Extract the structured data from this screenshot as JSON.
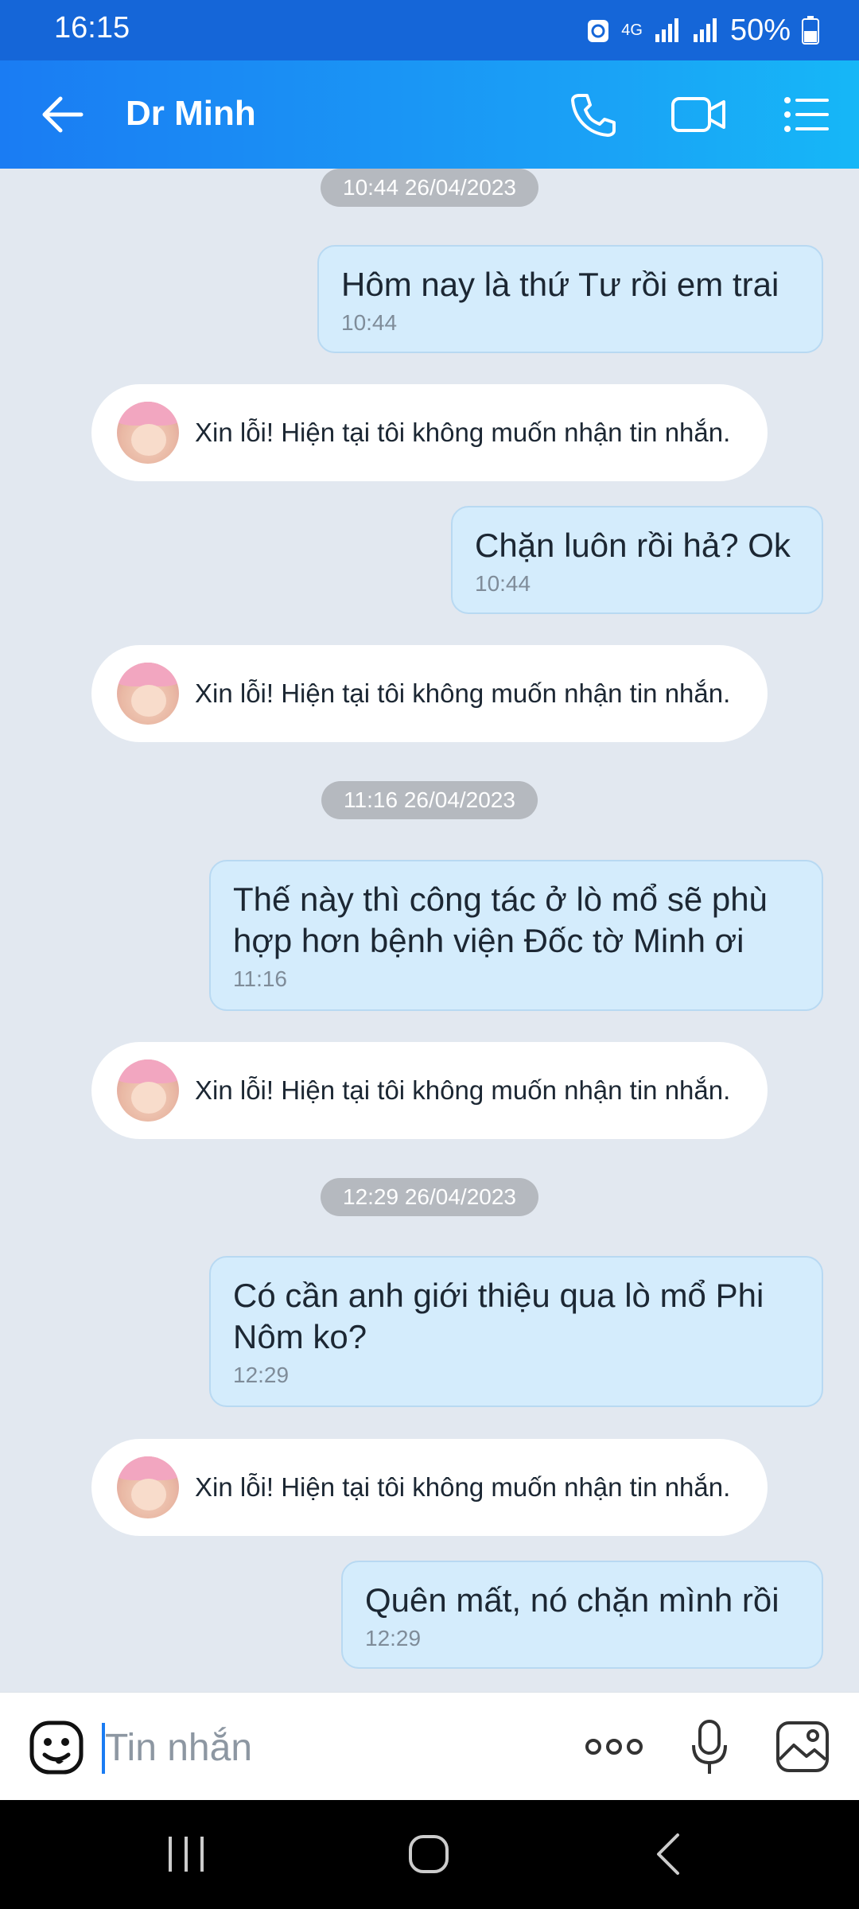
{
  "status": {
    "time": "16:15",
    "network": "4G",
    "battery": "50%"
  },
  "header": {
    "title": "Dr Minh",
    "icons": [
      "back-arrow-icon",
      "phone-icon",
      "video-call-icon",
      "menu-list-icon"
    ]
  },
  "auto_reply_text": "Xin lỗi! Hiện tại tôi không muốn nhận tin nhắn.",
  "messages": {
    "ts1": "10:44 26/04/2023",
    "m1": {
      "text": "Hôm nay là thứ Tư rồi em trai",
      "time": "10:44"
    },
    "r1": "Xin lỗi! Hiện tại tôi không muốn nhận tin nhắn.",
    "m2": {
      "text": "Chặn luôn rồi hả? Ok",
      "time": "10:44"
    },
    "r2": "Xin lỗi! Hiện tại tôi không muốn nhận tin nhắn.",
    "ts2": "11:16 26/04/2023",
    "m3": {
      "line1": "Thế này thì công tác ở lò mổ sẽ phù",
      "line2": "hợp hơn bệnh viện Đốc tờ Minh ơi",
      "time": "11:16"
    },
    "r3": "Xin lỗi! Hiện tại tôi không muốn nhận tin nhắn.",
    "ts3": "12:29 26/04/2023",
    "m4": {
      "line1": "Có cần anh giới thiệu qua lò mổ Phi",
      "line2": "Nôm ko?",
      "time": "12:29"
    },
    "r4": "Xin lỗi! Hiện tại tôi không muốn nhận tin nhắn.",
    "m5": {
      "text": "Quên mất, nó chặn mình rồi",
      "time": "12:29"
    }
  },
  "composer": {
    "placeholder": "Tin nhắn"
  },
  "colors": {
    "header": "#1a90f5",
    "outgoing_bubble": "#d4ecfc",
    "chat_bg": "#e2e8f0"
  }
}
